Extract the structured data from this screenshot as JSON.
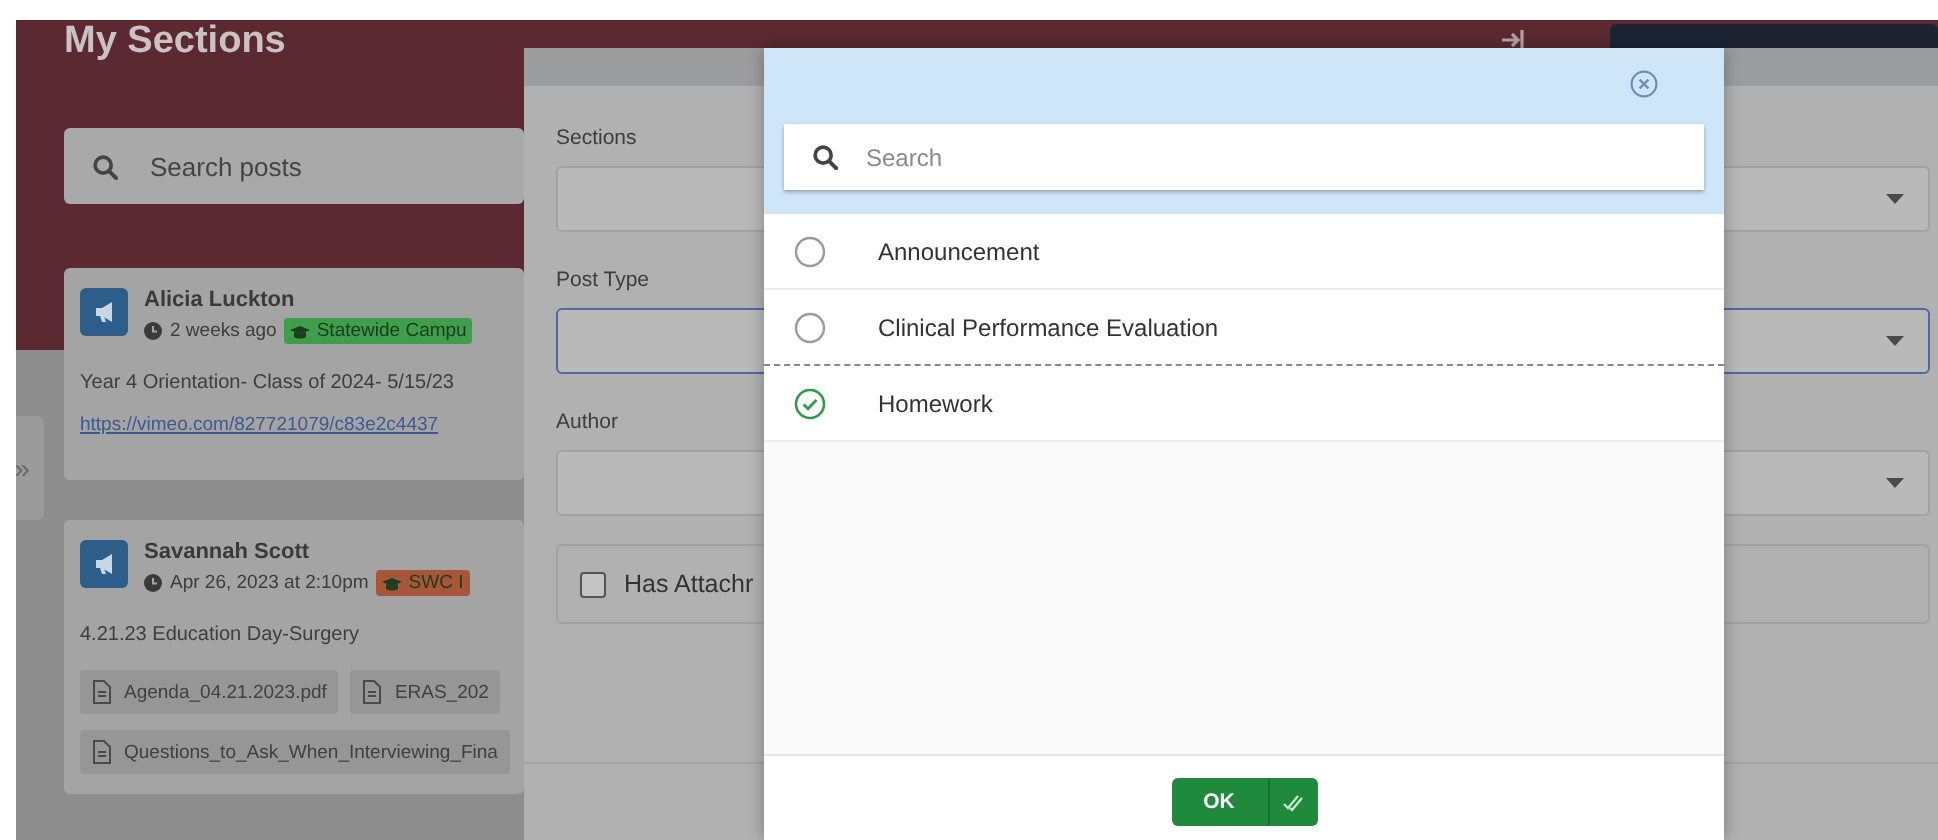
{
  "header": {
    "title": "My Sections"
  },
  "search": {
    "placeholder": "Search posts"
  },
  "sidebar_toggle": {
    "label": "»"
  },
  "posts": [
    {
      "author": "Alicia Luckton",
      "time": "2 weeks ago",
      "tag": {
        "label": "Statewide Campu",
        "color": "#3f9e4c"
      },
      "text": "Year 4 Orientation- Class of 2024- 5/15/23",
      "link": "https://vimeo.com/827721079/c83e2c4437"
    },
    {
      "author": "Savannah Scott",
      "time": "Apr 26, 2023 at 2:10pm",
      "tag": {
        "label": "SWC I",
        "color": "#a8563a"
      },
      "text": "4.21.23 Education Day-Surgery",
      "attachments": [
        "Agenda_04.21.2023.pdf",
        "ERAS_202",
        "Questions_to_Ask_When_Interviewing_Fina"
      ]
    }
  ],
  "filters": {
    "fields": [
      {
        "label": "Sections",
        "focused": false
      },
      {
        "label": "Post Type",
        "focused": true
      },
      {
        "label": "Author",
        "focused": false
      }
    ],
    "attachment_checkbox": {
      "label": "Has Attachr",
      "checked": false
    }
  },
  "picker": {
    "search": {
      "placeholder": "Search"
    },
    "options": [
      {
        "label": "Announcement",
        "selected": false
      },
      {
        "label": "Clinical Performance Evaluation",
        "selected": false
      },
      {
        "label": "Homework",
        "selected": true
      }
    ],
    "ok_button": {
      "label": "OK"
    }
  }
}
